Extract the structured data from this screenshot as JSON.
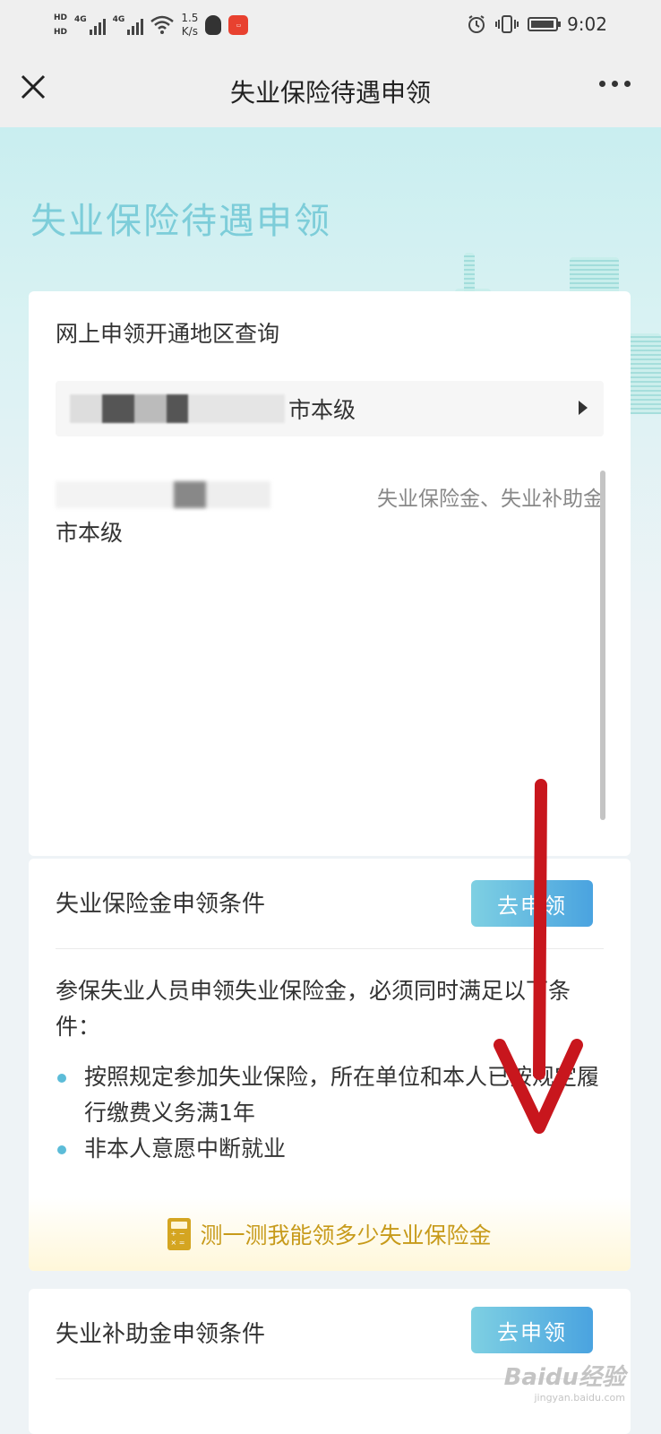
{
  "status_bar": {
    "hd1": "HD",
    "hd2": "HD",
    "net1": "4G",
    "net2": "4G",
    "speed_value": "1.5",
    "speed_unit": "K/s",
    "time": "9:02"
  },
  "nav": {
    "title": "失业保险待遇申领"
  },
  "hero": {
    "title": "失业保险待遇申领"
  },
  "region_query": {
    "heading": "网上申领开通地区查询",
    "selected_suffix": "市本级",
    "result_area": "市本级",
    "result_types": "失业保险金、失业补助金"
  },
  "insurance_section": {
    "title": "失业保险金申领条件",
    "apply_label": "去申领",
    "intro": "参保失业人员申领失业保险金，必须同时满足以下条件：",
    "conditions": [
      "按照规定参加失业保险，所在单位和本人已按规定履行缴费义务满1年",
      "非本人意愿中断就业"
    ],
    "calc_label": "测一测我能领多少失业保险金"
  },
  "subsidy_section": {
    "title": "失业补助金申领条件",
    "apply_label": "去申领"
  },
  "watermark": {
    "brand": "Baidu经验",
    "url": "jingyan.baidu.com"
  },
  "colors": {
    "accent": "#4aa3e0",
    "hero_title": "#7dcdd9",
    "calc_gold": "#c79a1a",
    "arrow_red": "#c8161d"
  }
}
